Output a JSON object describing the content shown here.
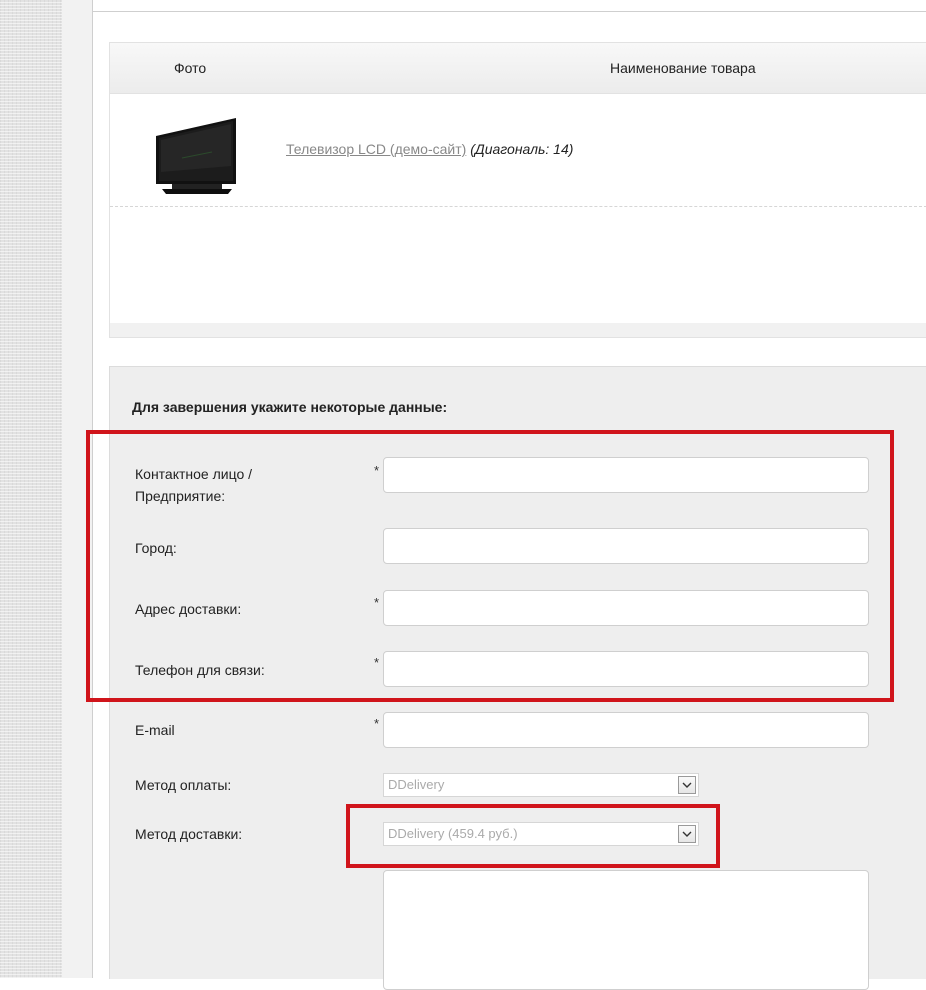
{
  "cart": {
    "header": {
      "photo": "Фото",
      "name": "Наименование товара"
    },
    "items": [
      {
        "name": "Телевизор LCD (демо-сайт)",
        "props": "(Диагональ: 14)",
        "image_icon": "tv-icon"
      }
    ]
  },
  "form": {
    "title": "Для завершения укажите некоторые данные:",
    "fields": {
      "contact": {
        "label": "Контактное лицо / Предприятие:",
        "required": "*",
        "value": ""
      },
      "city": {
        "label": "Город:",
        "value": ""
      },
      "address": {
        "label": "Адрес доставки:",
        "required": "*",
        "value": ""
      },
      "phone": {
        "label": "Телефон для связи:",
        "required": "*",
        "value": ""
      },
      "email": {
        "label": "E-mail",
        "required": "*",
        "value": ""
      },
      "payment": {
        "label": "Метод оплаты:",
        "selected": "DDelivery"
      },
      "delivery": {
        "label": "Метод доставки:",
        "selected": "DDelivery (459.4 руб.)"
      }
    }
  },
  "colors": {
    "highlight": "#d0141b",
    "form_bg": "#eeeeee"
  }
}
